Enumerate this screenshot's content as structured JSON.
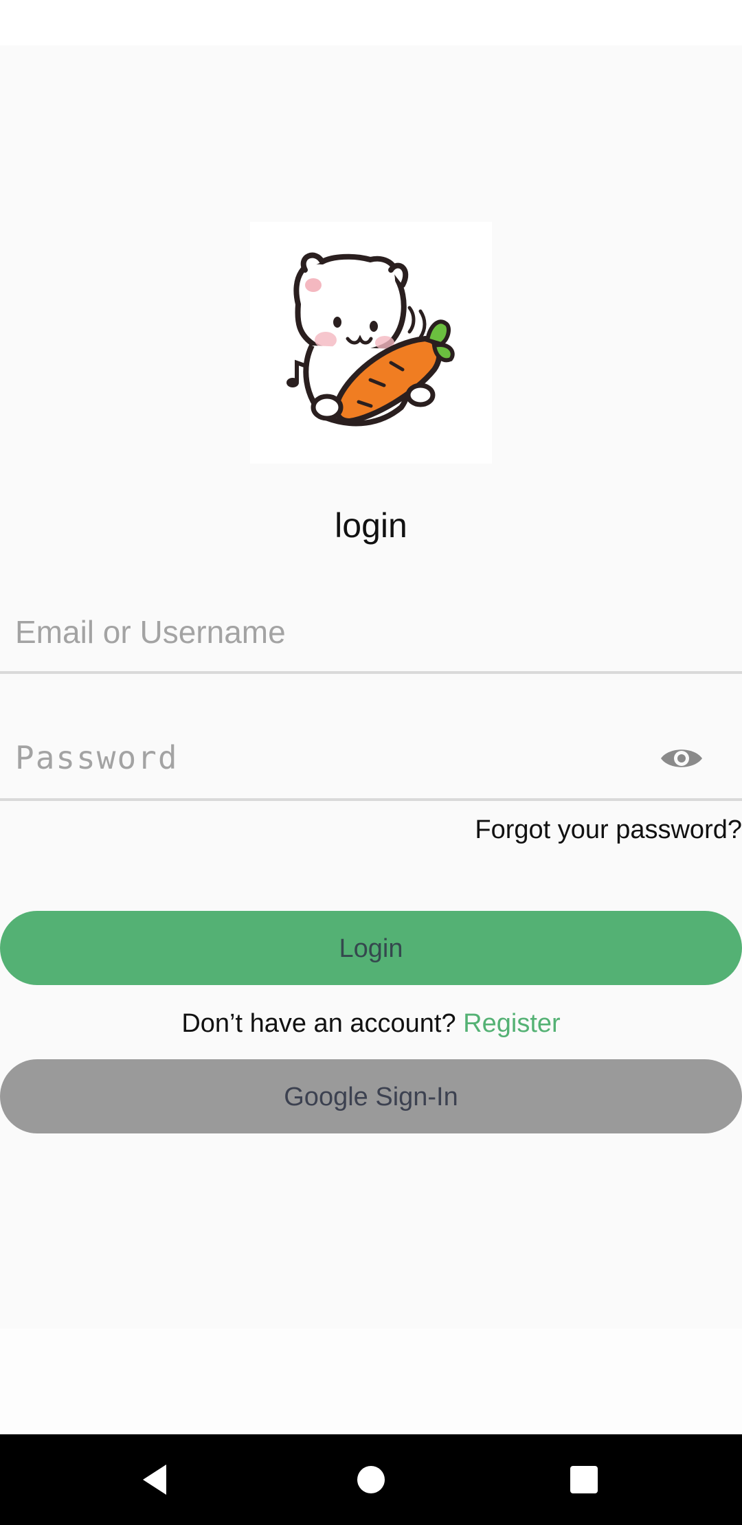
{
  "app": {
    "title": "login"
  },
  "form": {
    "email_placeholder": "Email or Username",
    "email_value": "",
    "password_placeholder": "Password",
    "password_value": "",
    "forgot_label": "Forgot your password?"
  },
  "actions": {
    "login_label": "Login",
    "register_prompt": "Don’t have an account?",
    "register_link": "Register",
    "google_label": "Google Sign-In"
  },
  "colors": {
    "accent_green": "#54b174",
    "google_button": "#9a9a9a",
    "background": "#fafafa"
  },
  "icons": {
    "logo": "bear-with-carrot-illustration",
    "password_toggle": "eye-icon",
    "nav_back": "back-triangle-icon",
    "nav_home": "home-circle-icon",
    "nav_recents": "recents-square-icon"
  }
}
